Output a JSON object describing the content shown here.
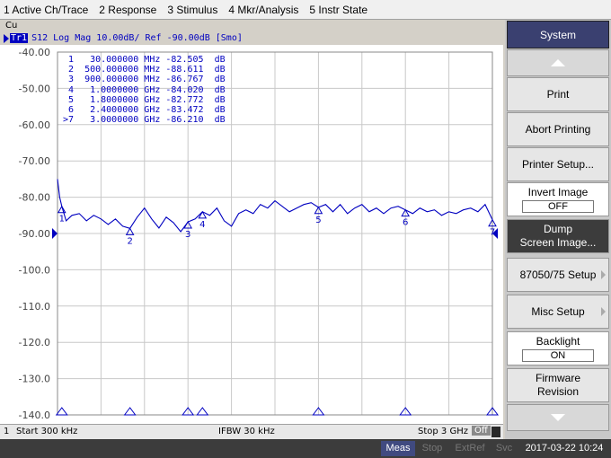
{
  "menu": [
    "1 Active Ch/Trace",
    "2 Response",
    "3 Stimulus",
    "4 Mkr/Analysis",
    "5 Instr State"
  ],
  "channel_label": "Cu",
  "trace": {
    "tag": "Tr1",
    "header": "S12 Log Mag 10.00dB/ Ref -90.00dB [Smo]"
  },
  "markers": [
    {
      "id": "1",
      "prefix": " ",
      "freq": "30.000000",
      "unit": "MHz",
      "value": "-82.505",
      "vunit": "dB"
    },
    {
      "id": "2",
      "prefix": " ",
      "freq": "500.000000",
      "unit": "MHz",
      "value": "-88.611",
      "vunit": "dB"
    },
    {
      "id": "3",
      "prefix": " ",
      "freq": "900.000000",
      "unit": "MHz",
      "value": "-86.767",
      "vunit": "dB"
    },
    {
      "id": "4",
      "prefix": " ",
      "freq": "1.0000000",
      "unit": "GHz",
      "value": "-84.020",
      "vunit": "dB"
    },
    {
      "id": "5",
      "prefix": " ",
      "freq": "1.8000000",
      "unit": "GHz",
      "value": "-82.772",
      "vunit": "dB"
    },
    {
      "id": "6",
      "prefix": " ",
      "freq": "2.4000000",
      "unit": "GHz",
      "value": "-83.472",
      "vunit": "dB"
    },
    {
      "id": "7",
      "prefix": ">",
      "freq": "3.0000000",
      "unit": "GHz",
      "value": "-86.210",
      "vunit": "dB"
    }
  ],
  "chart_data": {
    "type": "line",
    "xlabel": "",
    "ylabel": "",
    "x_start_mhz": 0.3,
    "x_stop_mhz": 3000,
    "ylim": [
      -140,
      -40
    ],
    "y_ticks": [
      "-40.00",
      "-50.00",
      "-60.00",
      "-70.00",
      "-80.00",
      "-90.00",
      "-100.0",
      "-110.0",
      "-120.0",
      "-130.0",
      "-140.0"
    ],
    "grid": true,
    "reference_level": -90,
    "series": [
      {
        "x": [
          0.3,
          15,
          30,
          60,
          100,
          150,
          200,
          250,
          300,
          350,
          400,
          450,
          500,
          550,
          600,
          650,
          700,
          750,
          800,
          850,
          900,
          950,
          1000,
          1050,
          1100,
          1150,
          1200,
          1250,
          1300,
          1350,
          1400,
          1450,
          1500,
          1550,
          1600,
          1650,
          1700,
          1750,
          1800,
          1850,
          1900,
          1950,
          2000,
          2050,
          2100,
          2150,
          2200,
          2250,
          2300,
          2350,
          2400,
          2450,
          2500,
          2550,
          2600,
          2650,
          2700,
          2750,
          2800,
          2850,
          2900,
          2950,
          3000
        ],
        "y": [
          -75.0,
          -80.0,
          -82.5,
          -86.5,
          -85.0,
          -84.5,
          -86.5,
          -85.0,
          -86.0,
          -87.5,
          -86.0,
          -88.0,
          -88.6,
          -85.5,
          -83.0,
          -86.0,
          -88.5,
          -85.5,
          -87.0,
          -89.5,
          -86.8,
          -86.0,
          -84.0,
          -85.0,
          -83.0,
          -86.5,
          -88.0,
          -84.5,
          -83.5,
          -84.5,
          -82.0,
          -83.0,
          -81.0,
          -82.5,
          -84.0,
          -83.0,
          -82.0,
          -81.5,
          -82.8,
          -82.0,
          -84.0,
          -82.0,
          -84.5,
          -83.0,
          -82.0,
          -84.0,
          -83.0,
          -84.5,
          -83.0,
          -82.5,
          -83.5,
          -84.5,
          -83.0,
          -84.0,
          -83.5,
          -85.0,
          -84.0,
          -84.5,
          -83.5,
          -83.0,
          -84.0,
          -82.0,
          -86.2
        ]
      }
    ]
  },
  "status": {
    "channel": "1",
    "start": "Start 300 kHz",
    "ifbw": "IFBW 30 kHz",
    "stop": "Stop 3 GHz",
    "off": "Off"
  },
  "bottombar": {
    "meas": "Meas",
    "stop": "Stop",
    "extref": "ExtRef",
    "svc": "Svc",
    "datetime": "2017-03-22 10:24"
  },
  "softkeys": {
    "title": "System",
    "buttons": [
      {
        "label": "Print"
      },
      {
        "label": "Abort Printing"
      },
      {
        "label": "Printer Setup..."
      },
      {
        "label": "Invert Image",
        "value": "OFF"
      },
      {
        "label": "Dump",
        "label2": "Screen Image..."
      },
      {
        "label": "87050/75 Setup"
      },
      {
        "label": "Misc Setup"
      },
      {
        "label": "Backlight",
        "value": "ON"
      },
      {
        "label": "Firmware",
        "label2": "Revision"
      }
    ]
  },
  "colors": {
    "trace": "#0000c0",
    "grid": "#c8c8c8",
    "panel_title": "#3a4070"
  }
}
